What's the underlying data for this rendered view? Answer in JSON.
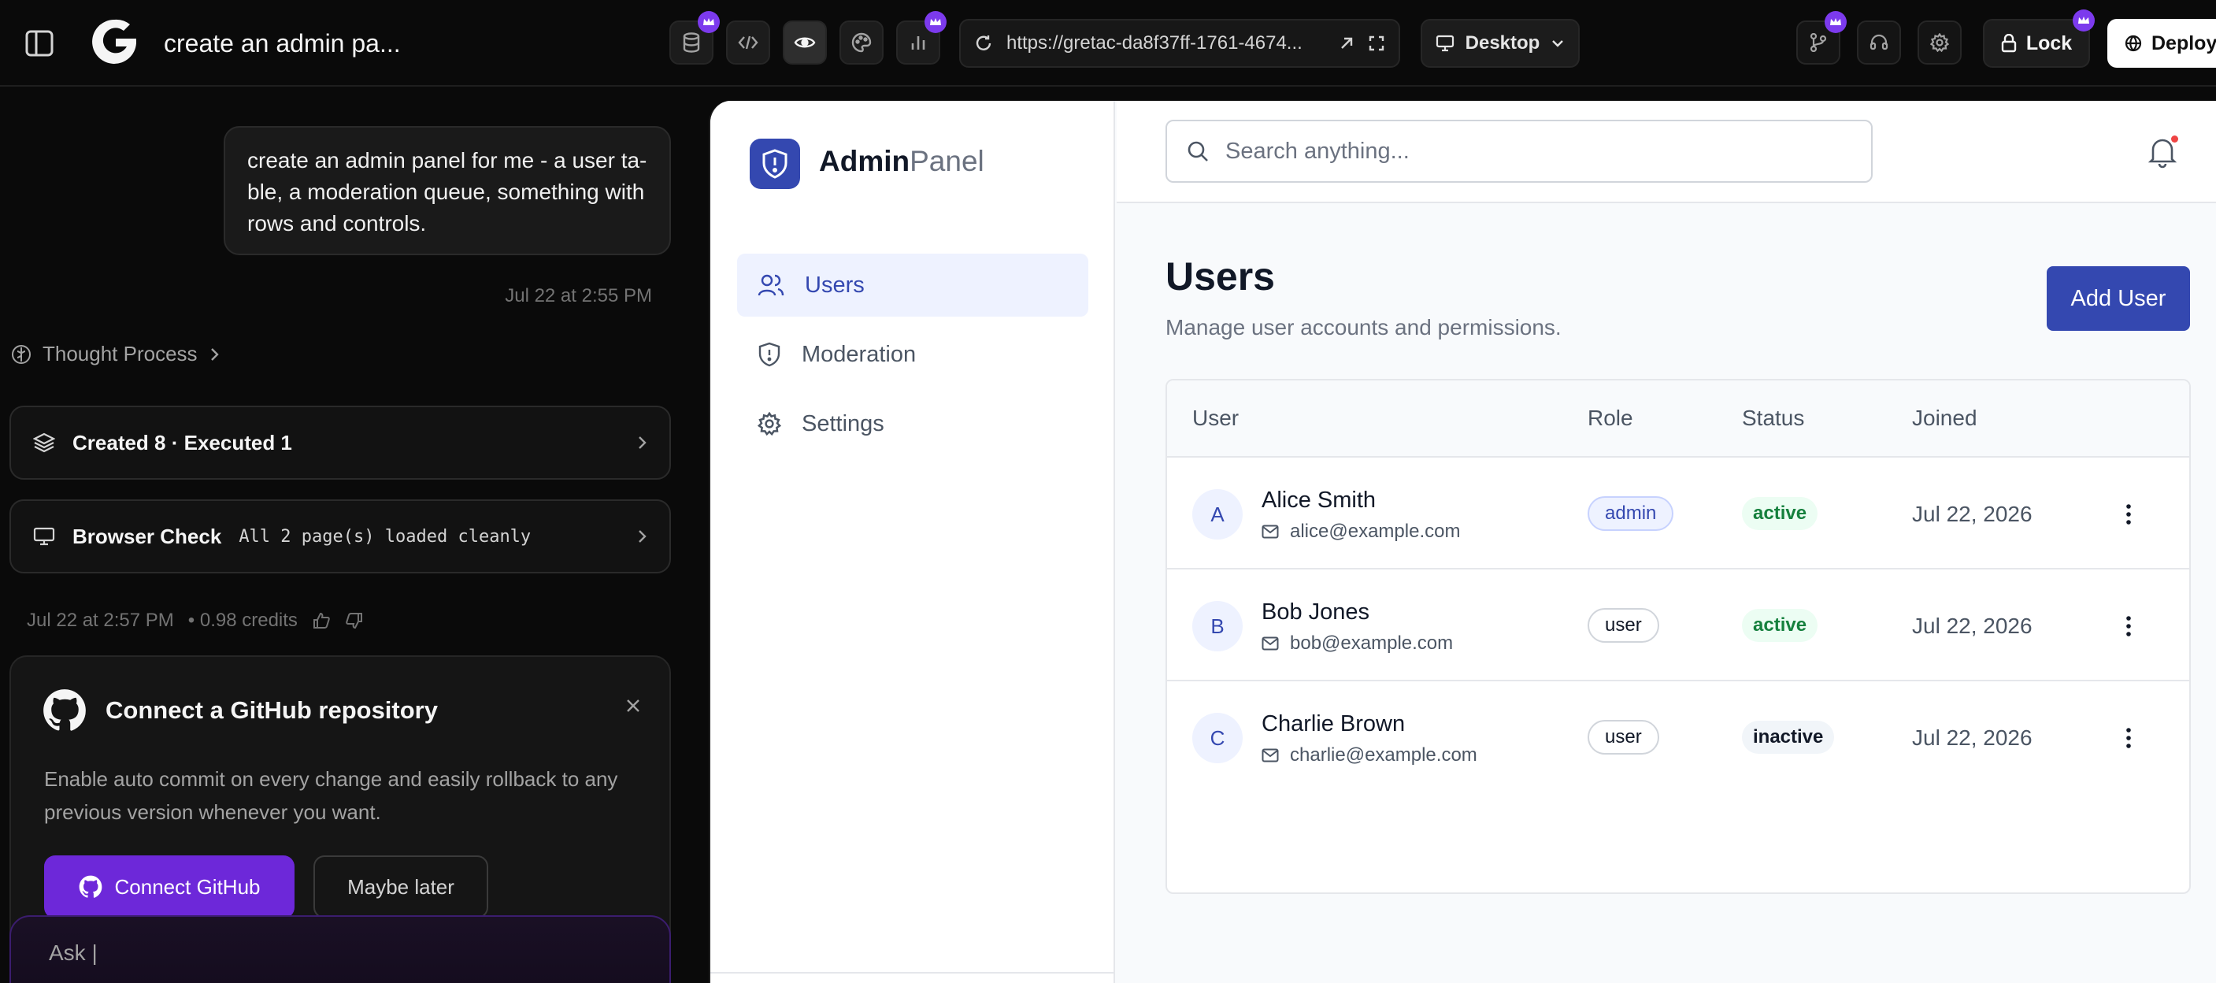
{
  "topbar": {
    "project_title": "create an admin pa...",
    "url": "https://gretac-da8f37ff-1761-4674...",
    "device": "Desktop",
    "lock_label": "Lock",
    "deploy_label": "Deploy"
  },
  "chat": {
    "user_message": "create an admin panel for me - a user ta-ble, a moderation queue, something with rows and controls.",
    "message_time": "Jul 22 at 2:55 PM",
    "thought_process": "Thought Process",
    "created_card": "Created 8 · Executed 1",
    "browser_check_title": "Browser Check",
    "browser_check_detail": "All 2 page(s) loaded cleanly",
    "credits_time": "Jul 22 at 2:57 PM",
    "credits": "• 0.98 credits",
    "github": {
      "title": "Connect a GitHub repository",
      "description": "Enable auto commit on every change and easily rollback to any previous version whenever you want.",
      "connect_label": "Connect GitHub",
      "later_label": "Maybe later"
    },
    "ask_placeholder": "Ask |"
  },
  "admin": {
    "brand_bold": "Admin",
    "brand_light": "Panel",
    "nav": [
      {
        "label": "Users",
        "icon": "users-icon",
        "active": true
      },
      {
        "label": "Moderation",
        "icon": "shield-alert-icon",
        "active": false
      },
      {
        "label": "Settings",
        "icon": "gear-icon",
        "active": false
      }
    ],
    "search_placeholder": "Search anything...",
    "page_title": "Users",
    "page_subtitle": "Manage user accounts and permissions.",
    "add_user_label": "Add User",
    "columns": [
      "User",
      "Role",
      "Status",
      "Joined"
    ],
    "rows": [
      {
        "initial": "A",
        "name": "Alice Smith",
        "email": "alice@example.com",
        "role": "admin",
        "status": "active",
        "joined": "Jul 22, 2026"
      },
      {
        "initial": "B",
        "name": "Bob Jones",
        "email": "bob@example.com",
        "role": "user",
        "status": "active",
        "joined": "Jul 22, 2026"
      },
      {
        "initial": "C",
        "name": "Charlie Brown",
        "email": "charlie@example.com",
        "role": "user",
        "status": "inactive",
        "joined": "Jul 22, 2026"
      }
    ]
  },
  "colors": {
    "accent": "#3448b0",
    "github_button": "#6d28d9",
    "crown_badge": "#7c3aed",
    "status_active": "#15803d"
  }
}
